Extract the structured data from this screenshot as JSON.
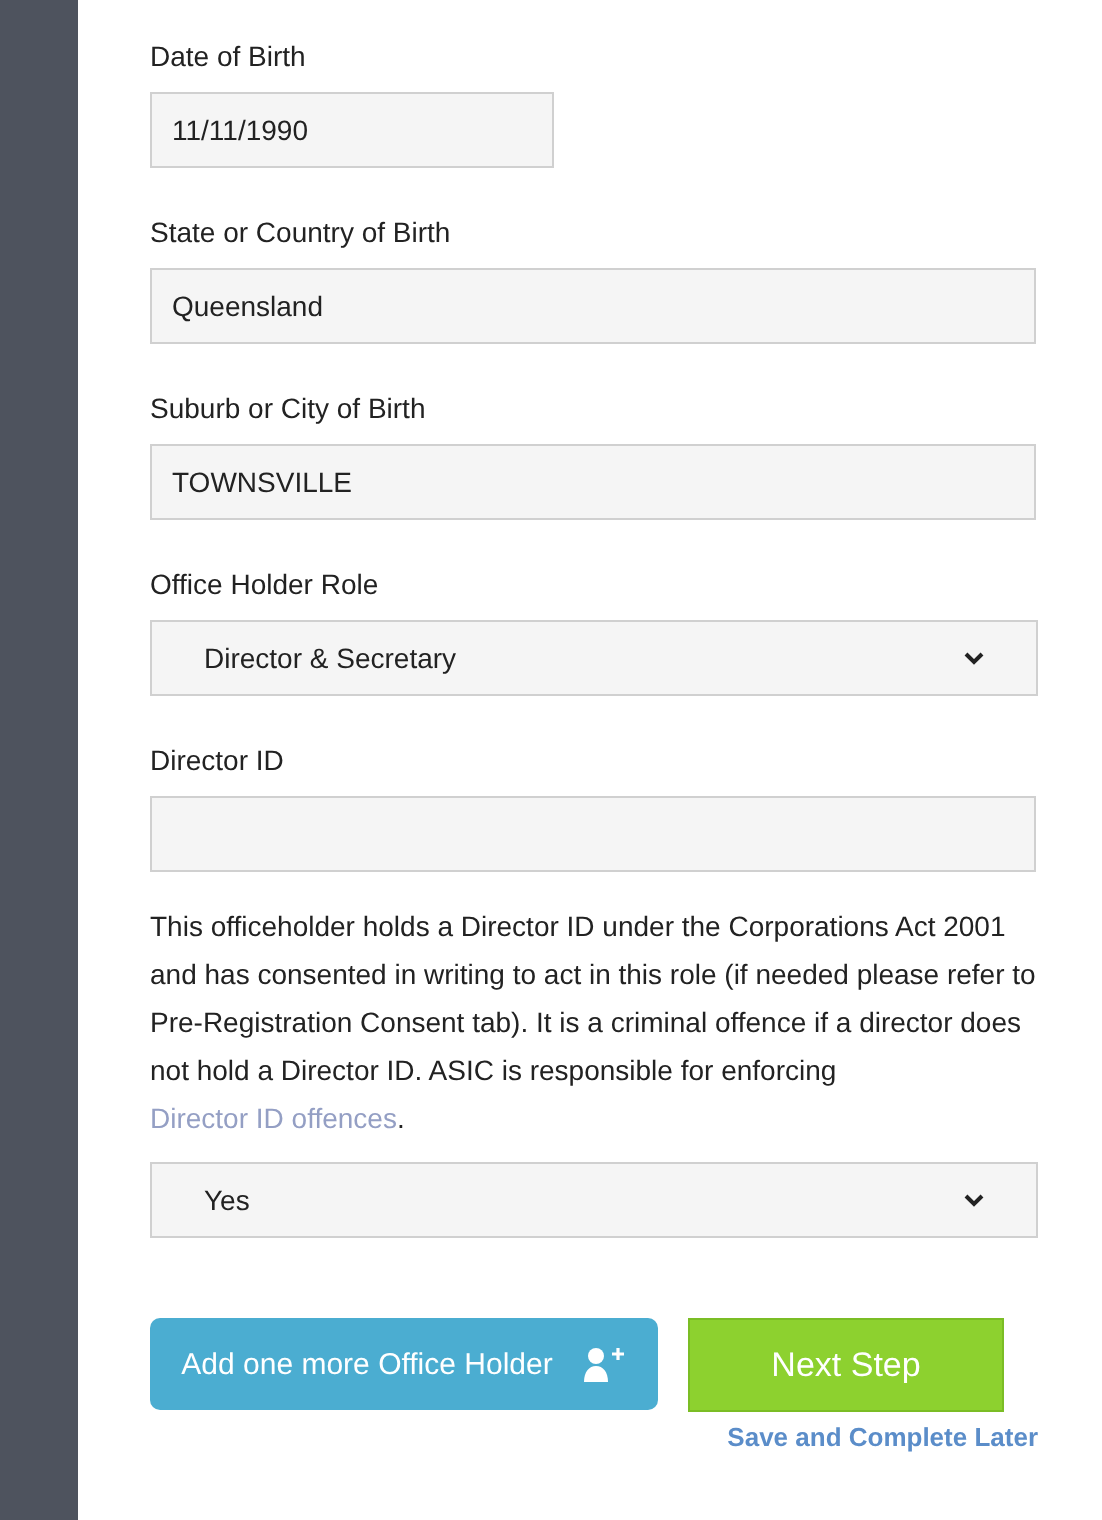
{
  "fields": [
    {
      "label": "Date of Birth",
      "kind": "date",
      "value": "11/11/1990"
    },
    {
      "label": "State or Country of Birth",
      "kind": "text",
      "value": "Queensland"
    },
    {
      "label": "Suburb or City of Birth",
      "kind": "text",
      "value": "TOWNSVILLE"
    },
    {
      "label": "Office Holder Role",
      "kind": "select",
      "value": "Director & Secretary"
    },
    {
      "label": "Director ID",
      "kind": "text"
    }
  ],
  "consent": {
    "text": "This officeholder holds a Director ID under the Corporations Act 2001 and has consented in writing to act in this role (if needed please refer to Pre-Registration Consent tab). It is a criminal offence if a director does not hold a Director ID. ASIC is responsible for enforcing ",
    "link": "Director ID offences",
    "after": ".",
    "answer": "Yes"
  },
  "buttons": {
    "add": "Add one more Office Holder",
    "next": "Next Step",
    "save_later": "Save and Complete Later"
  }
}
